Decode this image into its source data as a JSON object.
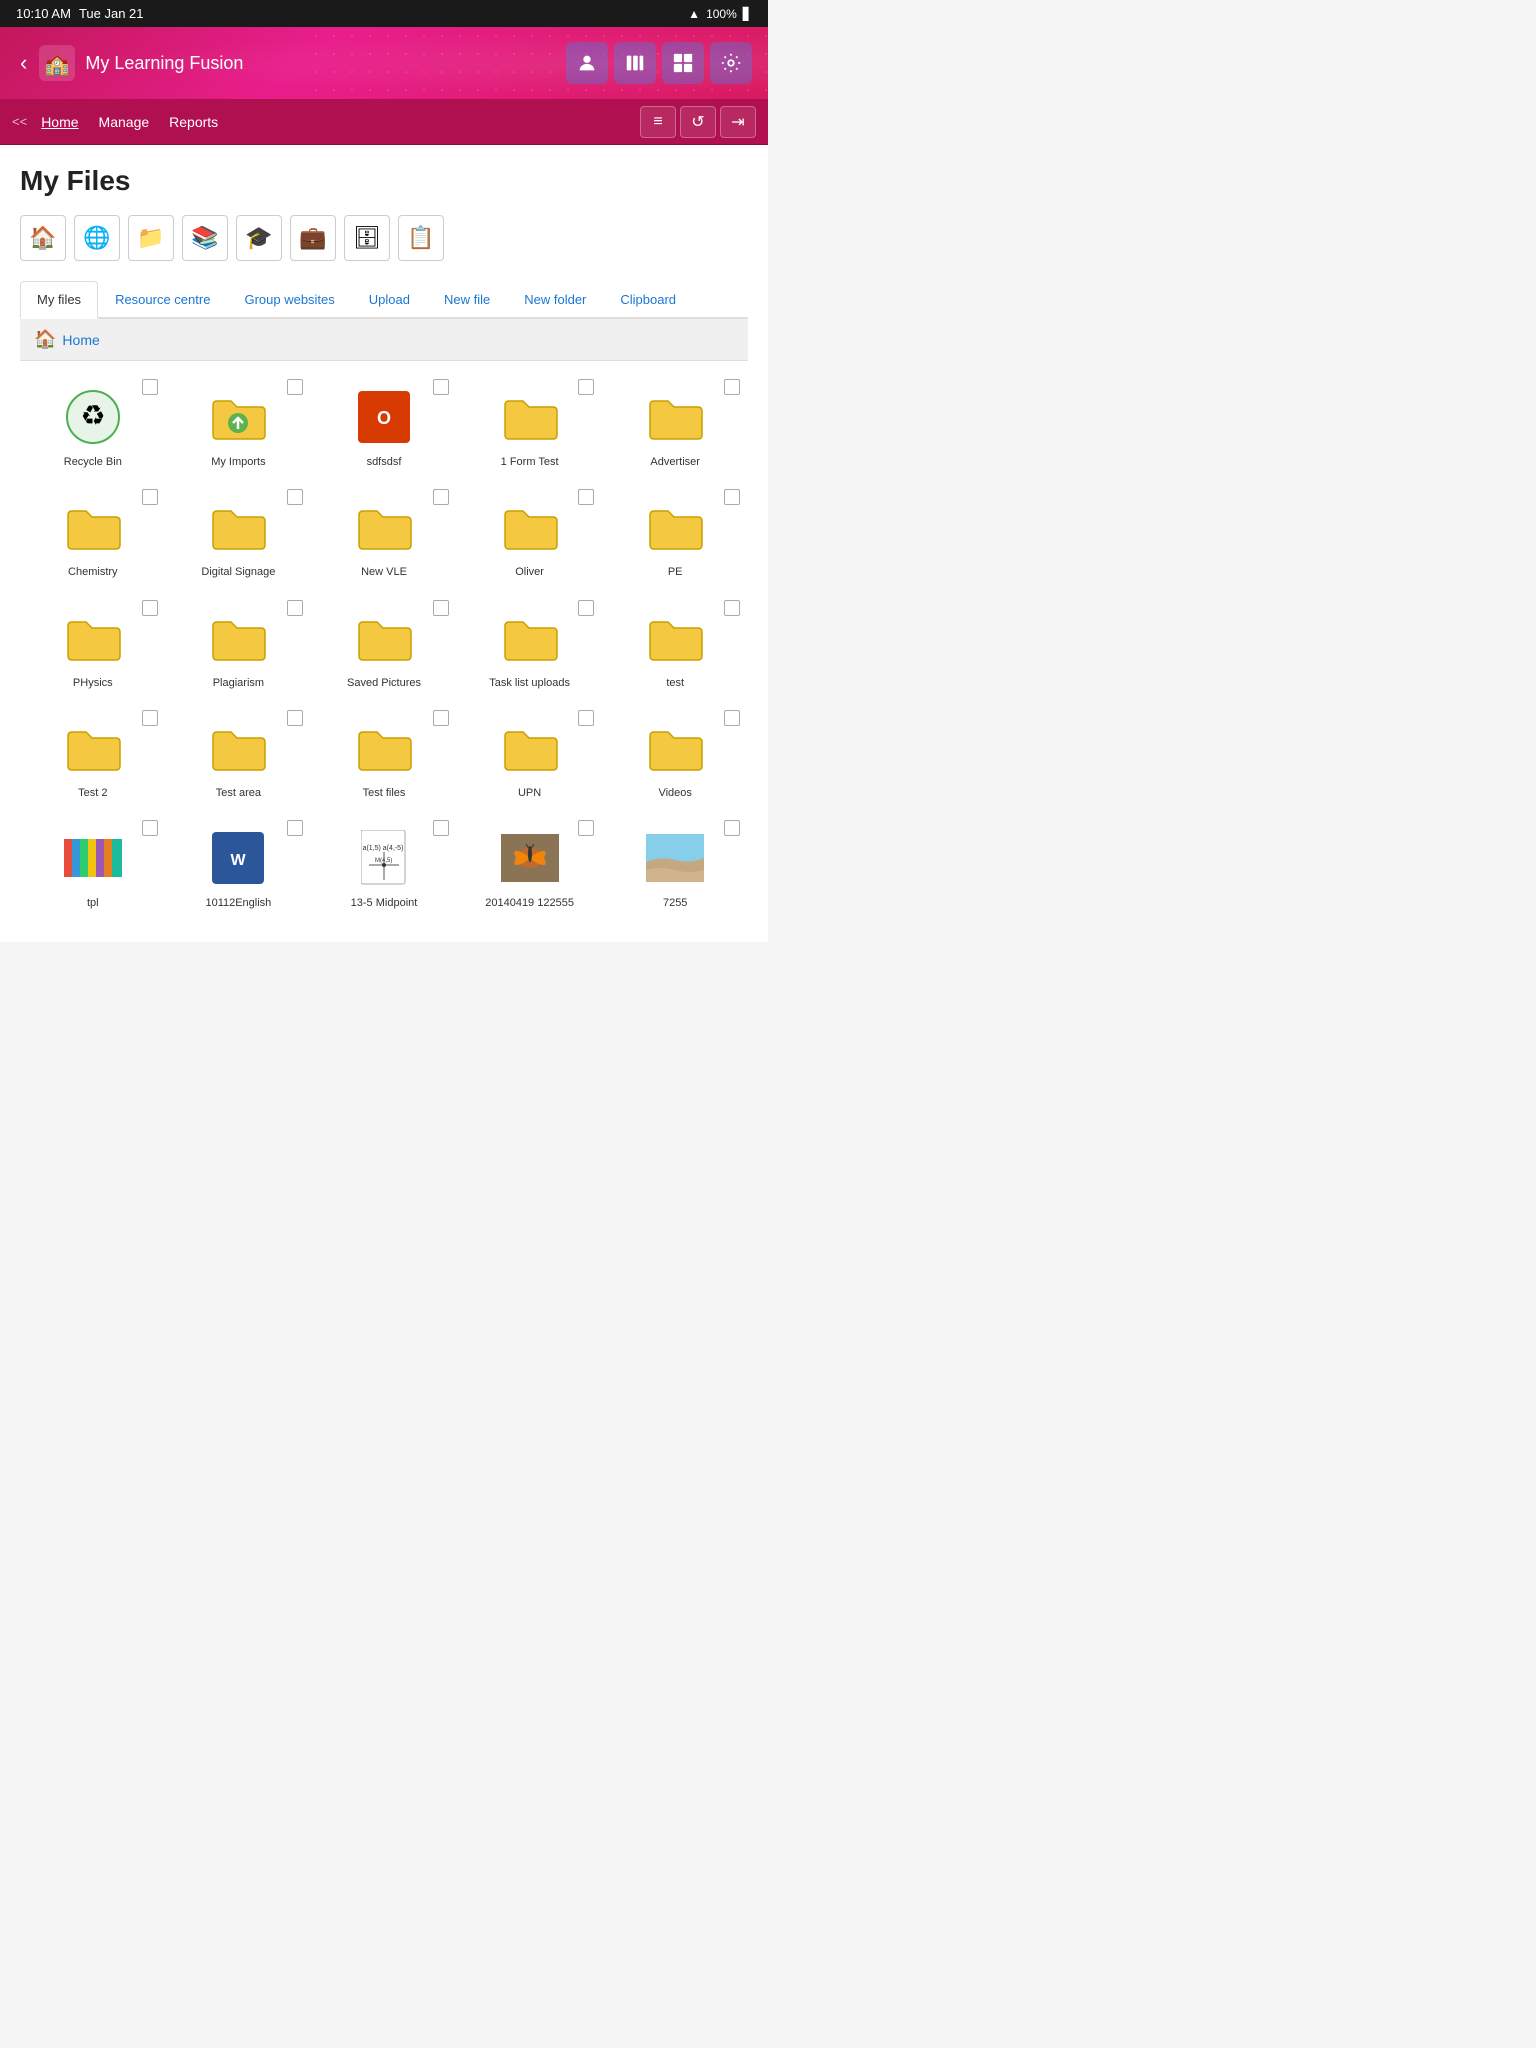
{
  "status_bar": {
    "time": "10:10 AM",
    "day": "Tue Jan 21",
    "wifi": "wifi",
    "battery": "100%"
  },
  "header": {
    "title": "My Learning Fusion",
    "back_label": "‹",
    "icons": [
      {
        "name": "person-icon",
        "symbol": "👤"
      },
      {
        "name": "books-icon",
        "symbol": "📚"
      },
      {
        "name": "diagram-icon",
        "symbol": "⊞"
      },
      {
        "name": "settings-icon",
        "symbol": "⚙"
      }
    ]
  },
  "nav": {
    "back_arrows": "<<",
    "links": [
      {
        "label": "Home",
        "active": true
      },
      {
        "label": "Manage",
        "active": false
      },
      {
        "label": "Reports",
        "active": false
      }
    ],
    "actions": [
      "≡",
      "↺",
      "→|"
    ]
  },
  "page_title": "My Files",
  "toolbar_icons": [
    "🏠",
    "🌐",
    "📁",
    "📚",
    "🎓",
    "💼",
    "🗄",
    "📋"
  ],
  "tabs": [
    {
      "label": "My files",
      "active": true
    },
    {
      "label": "Resource centre",
      "active": false
    },
    {
      "label": "Group websites",
      "active": false
    },
    {
      "label": "Upload",
      "active": false
    },
    {
      "label": "New file",
      "active": false
    },
    {
      "label": "New folder",
      "active": false
    },
    {
      "label": "Clipboard",
      "active": false
    }
  ],
  "breadcrumb": "Home",
  "files": [
    {
      "name": "Recycle Bin",
      "type": "recycle"
    },
    {
      "name": "My Imports",
      "type": "folder-import"
    },
    {
      "name": "sdfsdsf",
      "type": "office"
    },
    {
      "name": "1 Form Test",
      "type": "folder"
    },
    {
      "name": "Advertiser",
      "type": "folder"
    },
    {
      "name": "Chemistry",
      "type": "folder"
    },
    {
      "name": "Digital Signage",
      "type": "folder"
    },
    {
      "name": "New VLE",
      "type": "folder"
    },
    {
      "name": "Oliver",
      "type": "folder"
    },
    {
      "name": "PE",
      "type": "folder"
    },
    {
      "name": "PHysics",
      "type": "folder"
    },
    {
      "name": "Plagiarism",
      "type": "folder"
    },
    {
      "name": "Saved Pictures",
      "type": "folder"
    },
    {
      "name": "Task list uploads",
      "type": "folder"
    },
    {
      "name": "test",
      "type": "folder"
    },
    {
      "name": "Test 2",
      "type": "folder"
    },
    {
      "name": "Test area",
      "type": "folder"
    },
    {
      "name": "Test files",
      "type": "folder"
    },
    {
      "name": "UPN",
      "type": "folder"
    },
    {
      "name": "Videos",
      "type": "folder"
    },
    {
      "name": "tpl",
      "type": "image-strip"
    },
    {
      "name": "10112English",
      "type": "word"
    },
    {
      "name": "13-5 Midpoint",
      "type": "math"
    },
    {
      "name": "20140419 122555",
      "type": "photo-butterfly"
    },
    {
      "name": "7255",
      "type": "photo-sand"
    }
  ]
}
